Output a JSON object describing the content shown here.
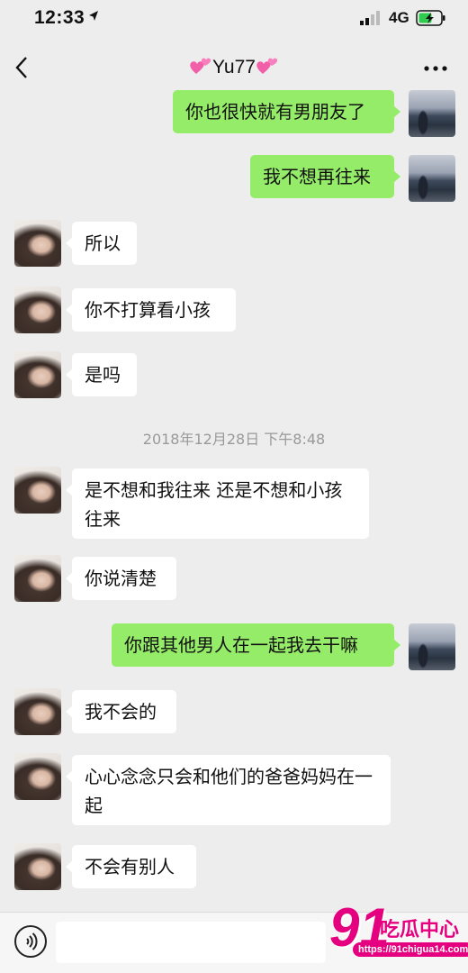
{
  "status_bar": {
    "time": "12:33",
    "network": "4G"
  },
  "header": {
    "title": "Yu77"
  },
  "messages": [
    {
      "side": "right",
      "text": "你也很快就有男朋友了"
    },
    {
      "side": "right",
      "text": "我不想再往来"
    },
    {
      "side": "left",
      "text": "所以"
    },
    {
      "side": "left",
      "text": "你不打算看小孩"
    },
    {
      "side": "left",
      "text": "是吗"
    },
    {
      "side": "left",
      "text": "是不想和我往来 还是不想和小孩往来"
    },
    {
      "side": "left",
      "text": "你说清楚"
    },
    {
      "side": "right",
      "text": "你跟其他男人在一起我去干嘛"
    },
    {
      "side": "left",
      "text": "我不会的"
    },
    {
      "side": "left",
      "text": "心心念念只会和他们的爸爸妈妈在一起"
    },
    {
      "side": "left",
      "text": "不会有别人"
    }
  ],
  "timestamp": "2018年12月28日 下午8:48",
  "watermark": {
    "logo": "91",
    "name": "吃瓜中心",
    "url": "https://91chigua14.com"
  },
  "colors": {
    "sent_bubble": "#95ec69",
    "received_bubble": "#ffffff",
    "background": "#ededed",
    "watermark": "#e5007f"
  }
}
